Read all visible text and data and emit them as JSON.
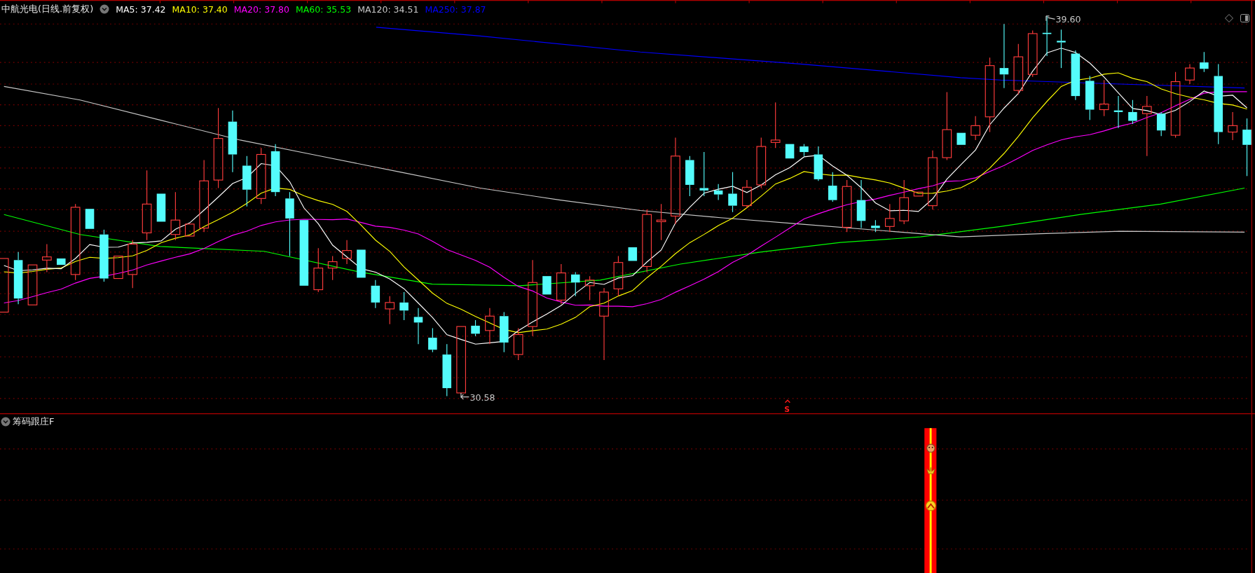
{
  "header": {
    "title": "中航光电(日线.前复权)",
    "moving_averages": [
      {
        "label": "MA5: 37.42",
        "color": "#ffffff"
      },
      {
        "label": "MA10: 37.40",
        "color": "#ffff00"
      },
      {
        "label": "MA20: 37.80",
        "color": "#ff00ff"
      },
      {
        "label": "MA60: 35.53",
        "color": "#00ff00"
      },
      {
        "label": "MA120: 34.51",
        "color": "#c8c8c8"
      },
      {
        "label": "MA250: 37.87",
        "color": "#0000ff"
      }
    ]
  },
  "chart": {
    "high_label": "39.60",
    "low_label": "30.58",
    "signal_label": "S"
  },
  "indicator": {
    "title": "筹码跟庄F"
  }
}
